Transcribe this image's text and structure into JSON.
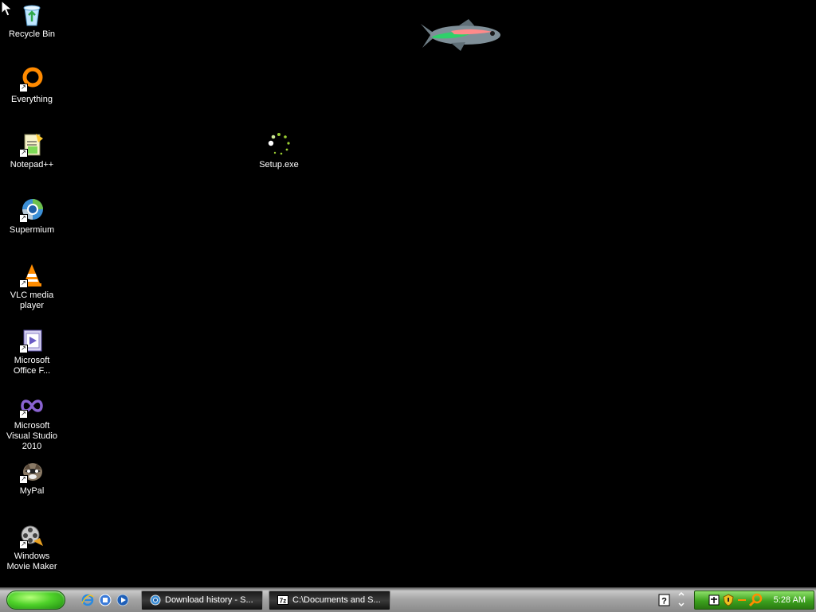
{
  "desktop": {
    "icons": [
      {
        "label": "Recycle Bin",
        "icon": "recycle-bin-icon"
      },
      {
        "label": "Everything",
        "icon": "everything-icon"
      },
      {
        "label": "Notepad++",
        "icon": "notepad-plus-plus-icon"
      },
      {
        "label": "Supermium",
        "icon": "supermium-icon"
      },
      {
        "label": "VLC media player",
        "icon": "vlc-icon"
      },
      {
        "label": "Microsoft Office F...",
        "icon": "office-form-icon"
      },
      {
        "label": "Microsoft Visual Studio 2010",
        "icon": "visual-studio-icon"
      },
      {
        "label": "MyPal",
        "icon": "mypal-icon"
      },
      {
        "label": "Windows Movie Maker",
        "icon": "movie-maker-icon"
      },
      {
        "label": "Setup.exe",
        "icon": "setup-loading-icon"
      }
    ]
  },
  "taskbar": {
    "tasks": [
      {
        "label": "Download history - S...",
        "icon": "browser-icon"
      },
      {
        "label": "C:\\Documents and S...",
        "icon": "7zip-icon",
        "icon_text": "7z"
      }
    ],
    "clock": "5:28 AM"
  },
  "colors": {
    "desktop": "#000000",
    "start": "#4fd22a",
    "tray": "#3da21e"
  }
}
